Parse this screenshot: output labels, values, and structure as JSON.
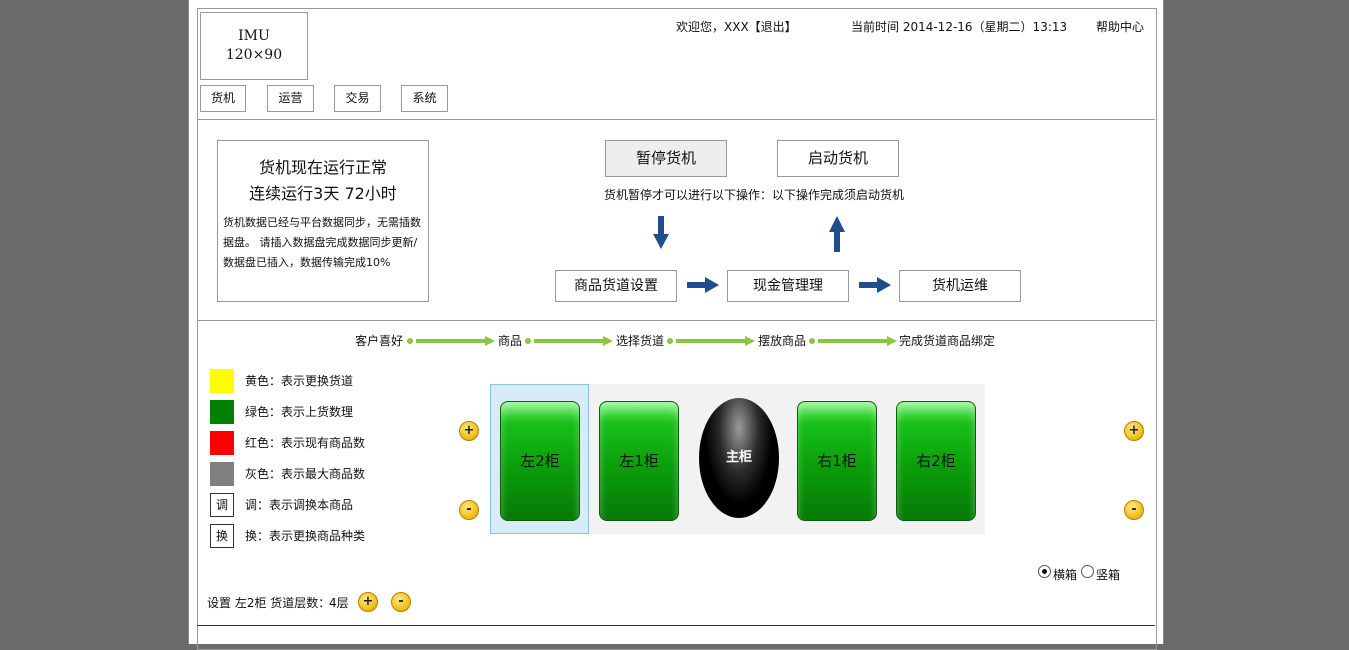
{
  "header": {
    "logo_line1": "IMU",
    "logo_line2": "120×90",
    "welcome": "欢迎您，XXX【退出】",
    "current_time": "当前时间 2014-12-16（星期二）13:13",
    "help": "帮助中心"
  },
  "nav": [
    {
      "label": "货机"
    },
    {
      "label": "运营"
    },
    {
      "label": "交易"
    },
    {
      "label": "系统"
    }
  ],
  "status": {
    "line1": "货机现在运行正常",
    "line2": "连续运行3天 72小时",
    "desc": "货机数据已经与平台数据同步，无需插数据盘。 请插入数据盘完成数据同步更新/数据盘已插入，数据传输完成10%"
  },
  "controls": {
    "pause_label": "暂停货机",
    "start_label": "启动货机",
    "pause_note": "货机暂停才可以进行以下操作：",
    "start_note": "以下操作完成须启动货机"
  },
  "flow": [
    {
      "label": "商品货道设置"
    },
    {
      "label": "现金管理理"
    },
    {
      "label": "货机运维"
    }
  ],
  "steps": [
    {
      "label": "客户喜好"
    },
    {
      "label": "商品"
    },
    {
      "label": "选择货道"
    },
    {
      "label": "摆放商品"
    },
    {
      "label": "完成货道商品绑定"
    }
  ],
  "legend": [
    {
      "color": "#ffff00",
      "text": "黄色：表示更换货道"
    },
    {
      "color": "#008000",
      "text": "绿色：表示上货数理"
    },
    {
      "color": "#ff0000",
      "text": "红色：表示现有商品数"
    },
    {
      "color": "#808080",
      "text": "灰色：表示最大商品数"
    },
    {
      "box": "调",
      "text": "调：表示调换本商品"
    },
    {
      "box": "换",
      "text": "换：表示更换商品种类"
    }
  ],
  "cabinets": [
    {
      "label": "左2柜",
      "selected": true
    },
    {
      "label": "左1柜"
    },
    {
      "label": "主柜"
    },
    {
      "label": "右1柜"
    },
    {
      "label": "右2柜"
    }
  ],
  "buttons": {
    "plus": "+",
    "minus": "-"
  },
  "orientation": {
    "options": [
      "横箱",
      "竖箱"
    ],
    "selected": "横箱"
  },
  "layers": {
    "label": "设置 左2柜 货道层数：",
    "value": "4层"
  }
}
